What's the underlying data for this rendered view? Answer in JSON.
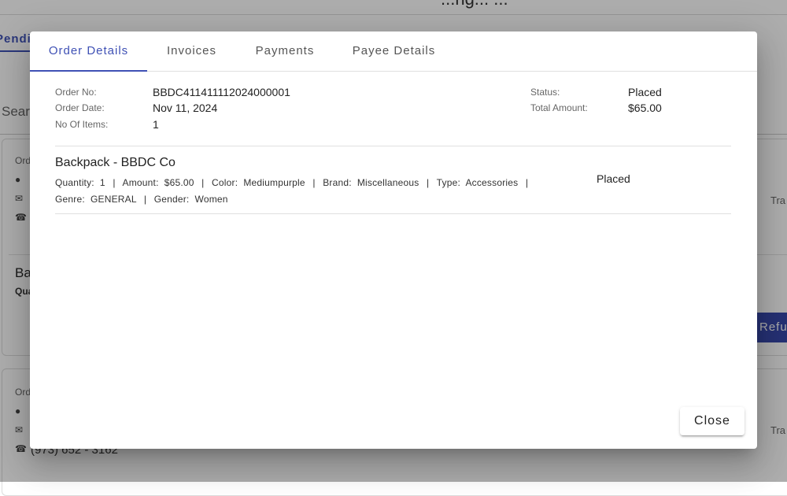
{
  "background": {
    "title_fragment": "...ng... ...",
    "tab_fragment": "Pendi",
    "search_fragment": "Sear",
    "card1": {
      "order_label_fragment": "Ord",
      "product_fragment": "Ba",
      "qty_fragment": "Qua",
      "side_fragment": "Tra"
    },
    "card2": {
      "order_label_fragment": "Ord",
      "phone": "(973) 652 - 3162",
      "side_fragment": "Tra"
    },
    "refund_fragment": "Refu"
  },
  "modal": {
    "tabs": [
      {
        "label": "Order Details",
        "active": true
      },
      {
        "label": "Invoices",
        "active": false
      },
      {
        "label": "Payments",
        "active": false
      },
      {
        "label": "Payee Details",
        "active": false
      }
    ],
    "order": {
      "order_no_label": "Order No:",
      "order_no": "BBDC411411112024000001",
      "order_date_label": "Order Date:",
      "order_date": "Nov 11, 2024",
      "items_label": "No Of Items:",
      "items": "1",
      "status_label": "Status:",
      "status": "Placed",
      "total_label": "Total Amount:",
      "total": "$65.00"
    },
    "item": {
      "name": "Backpack - BBDC Co",
      "quantity_label": "Quantity:",
      "quantity": "1",
      "amount_label": "Amount:",
      "amount": "$65.00",
      "color_label": "Color:",
      "color": "Mediumpurple",
      "brand_label": "Brand:",
      "brand": "Miscellaneous",
      "type_label": "Type:",
      "type": "Accessories",
      "genre_label": "Genre:",
      "genre": "GENERAL",
      "gender_label": "Gender:",
      "gender": "Women",
      "separator": "|",
      "status": "Placed"
    },
    "close_label": "Close"
  },
  "colors": {
    "accent": "#3f51b5",
    "overlay": "rgba(0,0,0,0.32)"
  }
}
